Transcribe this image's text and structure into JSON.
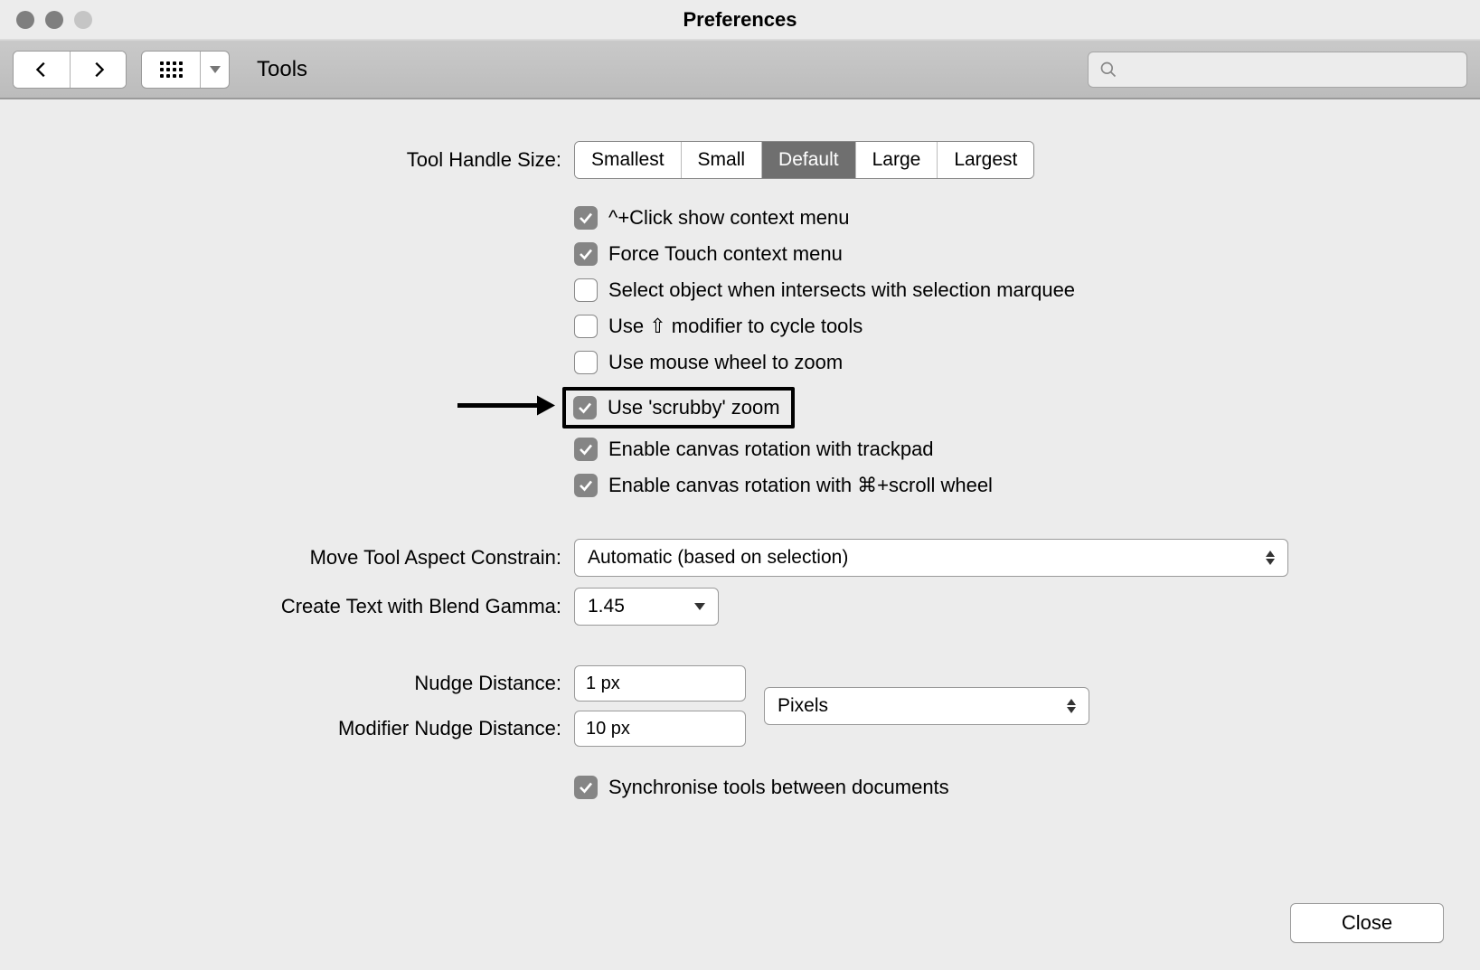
{
  "window": {
    "title": "Preferences"
  },
  "toolbar": {
    "section": "Tools",
    "search_placeholder": ""
  },
  "tool_handle": {
    "label": "Tool Handle Size:",
    "options": [
      "Smallest",
      "Small",
      "Default",
      "Large",
      "Largest"
    ],
    "selected_index": 2
  },
  "checkboxes": {
    "ctrl_click": {
      "label": "^+Click show context menu",
      "checked": true
    },
    "force_touch": {
      "label": "Force Touch context menu",
      "checked": true
    },
    "select_intersect": {
      "label": "Select object when intersects with selection marquee",
      "checked": false
    },
    "shift_cycle": {
      "label": "Use ⇧ modifier to cycle tools",
      "checked": false
    },
    "wheel_zoom": {
      "label": "Use mouse wheel to zoom",
      "checked": false
    },
    "scrubby_zoom": {
      "label": "Use 'scrubby' zoom",
      "checked": true,
      "highlighted": true
    },
    "canvas_rot_trackpad": {
      "label": "Enable canvas rotation with trackpad",
      "checked": true
    },
    "canvas_rot_scroll": {
      "label": "Enable canvas rotation with ⌘+scroll wheel",
      "checked": true
    },
    "sync_tools": {
      "label": "Synchronise tools between documents",
      "checked": true
    }
  },
  "move_constrain": {
    "label": "Move Tool Aspect Constrain:",
    "value": "Automatic (based on selection)"
  },
  "blend_gamma": {
    "label": "Create Text with Blend Gamma:",
    "value": "1.45"
  },
  "nudge": {
    "label": "Nudge Distance:",
    "value": "1 px"
  },
  "mod_nudge": {
    "label": "Modifier Nudge Distance:",
    "value": "10 px"
  },
  "nudge_units": {
    "value": "Pixels"
  },
  "close": {
    "label": "Close"
  }
}
